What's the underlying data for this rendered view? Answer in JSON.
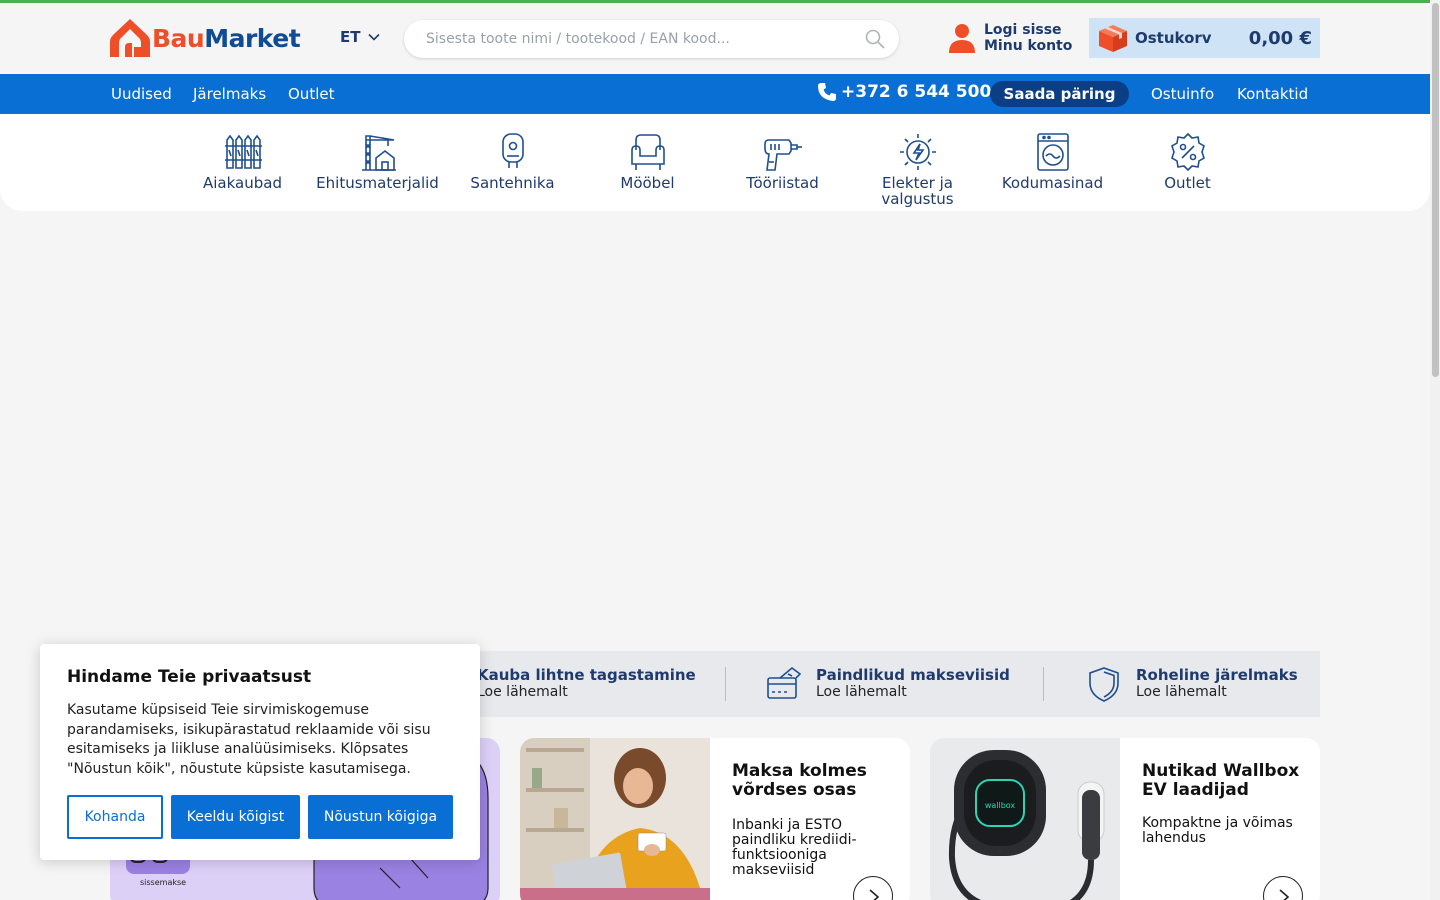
{
  "header": {
    "logo_bau": "Bau",
    "logo_market": "Market",
    "language": "ET",
    "search_placeholder": "Sisesta toote nimi / tootekood / EAN kood...",
    "login_label": "Logi sisse",
    "account_label": "Minu konto",
    "cart_label": "Ostukorv",
    "cart_amount": "0,00 €"
  },
  "navbar": {
    "left": [
      "Uudised",
      "Järelmaks",
      "Outlet"
    ],
    "phone": "+372 6 544 500",
    "request_button": "Saada päring",
    "right": [
      "Ostuinfo",
      "Kontaktid"
    ]
  },
  "categories": [
    {
      "label": "Aiakaubad",
      "icon": "fence-icon"
    },
    {
      "label": "Ehitusmaterjalid",
      "icon": "crane-house-icon"
    },
    {
      "label": "Santehnika",
      "icon": "water-heater-icon"
    },
    {
      "label": "Mööbel",
      "icon": "armchair-icon"
    },
    {
      "label": "Tööriistad",
      "icon": "drill-icon"
    },
    {
      "label": "Elekter ja valgustus",
      "icon": "power-icon"
    },
    {
      "label": "Kodumasinad",
      "icon": "washing-machine-icon"
    },
    {
      "label": "Outlet",
      "icon": "percent-badge-icon"
    }
  ],
  "features": [
    {
      "title": "Kauba lihtne tagastamine",
      "sub": "Loe lähemalt"
    },
    {
      "title": "Paindlikud makseviisid",
      "sub": "Loe lähemalt"
    },
    {
      "title": "Roheline järelmaks",
      "sub": "Loe lähemalt"
    }
  ],
  "promo_cards": [
    {
      "title": "",
      "sub": "",
      "image_caption": "sissemakse"
    },
    {
      "title": "Maksa kolmes võrdses osas",
      "sub": "Inbanki ja ESTO paindliku krediidi-funktsiooniga makseviisid"
    },
    {
      "title": "Nutikad Wallbox EV laadijad",
      "sub": "Kompaktne ja võimas lahendus",
      "image_brand": "wallbox"
    }
  ],
  "cookie": {
    "title": "Hindame Teie privaatsust",
    "text": "Kasutame küpsiseid Teie sirvimiskogemuse parandamiseks, isikupärastatud reklaamide või sisu esitamiseks ja liikluse analüüsimiseks. Klõpsates \"Nõustun kõik\", nõustute küpsiste kasutamisega.",
    "customize": "Kohanda",
    "reject": "Keeldu kõigist",
    "accept": "Nõustun kõigiga"
  },
  "colors": {
    "brand_orange": "#ee4e28",
    "brand_blue": "#0f4c95",
    "nav_blue": "#0a6fd4",
    "accent_green": "#4caf50"
  }
}
